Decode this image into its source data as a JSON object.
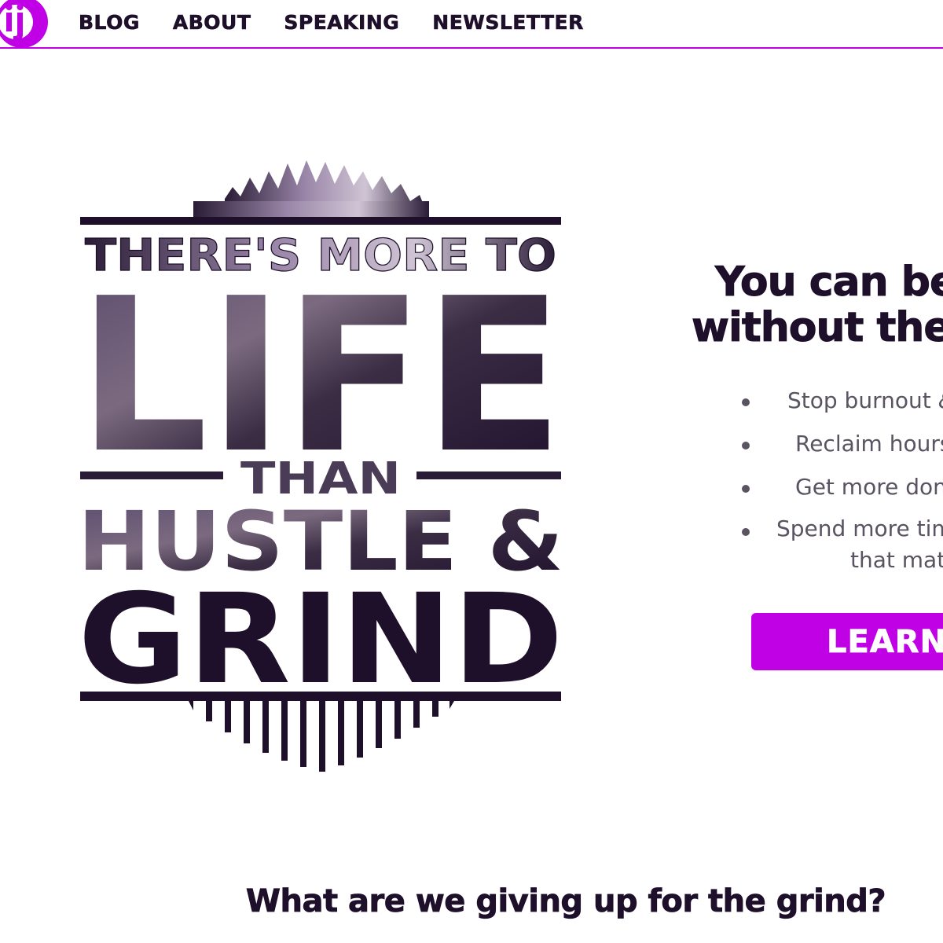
{
  "header": {
    "logo_letters": "ij",
    "nav": [
      "BLOG",
      "ABOUT",
      "SPEAKING",
      "NEWSLETTER"
    ]
  },
  "hero": {
    "poster_lines": [
      "THERE'S MORE TO",
      "LIFE",
      "THAN",
      "HUSTLE &",
      "GRIND"
    ]
  },
  "promo": {
    "title_line1": "You can be",
    "title_line2": "without the",
    "benefits": [
      {
        "text": "Stop burnout",
        "suffix": "&"
      },
      {
        "text": "Reclaim hours"
      },
      {
        "text": "Get more don"
      },
      {
        "text": "Spend more tim",
        "line2": "that mat"
      }
    ],
    "button_label": "LEARN"
  },
  "section": {
    "title": "What are we giving up for the grind?"
  },
  "colors": {
    "brand": "#c000e5",
    "ink": "#1e0f2b",
    "muted": "#5a5361"
  }
}
